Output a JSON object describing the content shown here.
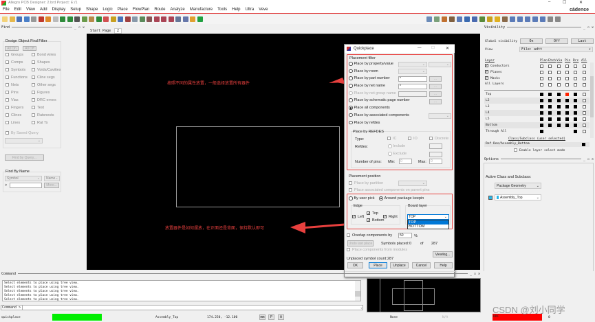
{
  "window": {
    "title": "Allegro PCB Designer: 2.brd  Project: E:/1",
    "brand": "cādence",
    "controls": [
      "–",
      "☐",
      "✕"
    ]
  },
  "menu": [
    "File",
    "Edit",
    "View",
    "Add",
    "Display",
    "Setup",
    "Shape",
    "Logic",
    "Place",
    "FlowPlan",
    "Route",
    "Analyze",
    "Manufacture",
    "Tools",
    "Help",
    "Ultra",
    "Veve"
  ],
  "toolbar_icons": [
    {
      "name": "new-file-icon",
      "color": "#f3d27a"
    },
    {
      "name": "open-folder-icon",
      "color": "#e6b84b"
    },
    {
      "name": "save-icon",
      "color": "#4a72b8"
    },
    {
      "name": "move-icon",
      "color": "#4a7fc8"
    },
    {
      "name": "copy-icon",
      "color": "#999999"
    },
    {
      "name": "delete-icon",
      "color": "#c0392b"
    },
    {
      "name": "undo-icon",
      "color": "#e08a2a"
    },
    {
      "name": "redo-icon",
      "color": "#bbbbbb"
    },
    {
      "name": "shape-icon",
      "color": "#2e8b3a"
    },
    {
      "name": "pin-icon",
      "color": "#2e8b3a"
    },
    {
      "name": "line-icon",
      "color": "#555555"
    },
    {
      "name": "text-add-icon",
      "color": "#6a9a4a"
    },
    {
      "name": "text-edit-icon",
      "color": "#b88a4a"
    },
    {
      "name": "layer-icon",
      "color": "#2e8b3a"
    },
    {
      "name": "frame-icon",
      "color": "#d05050"
    },
    {
      "name": "connect-icon",
      "color": "#c8a020"
    },
    {
      "name": "route-icon",
      "color": "#4a72b8"
    },
    {
      "name": "slide-icon",
      "color": "#a04040"
    },
    {
      "name": "grid-icon",
      "color": "#8899aa"
    },
    {
      "name": "grid2-icon",
      "color": "#5a8a5a"
    },
    {
      "name": "zoom-fit-icon",
      "color": "#885555"
    },
    {
      "name": "zoom-in-icon",
      "color": "#aa4455"
    },
    {
      "name": "zoom-out-icon",
      "color": "#aa4455"
    },
    {
      "name": "zoom-prev-icon",
      "color": "#aa4455"
    },
    {
      "name": "zoom-world-icon",
      "color": "#667799"
    },
    {
      "name": "zoom-select-icon",
      "color": "#6677aa"
    },
    {
      "name": "refresh-icon",
      "color": "#e0a030"
    },
    {
      "name": "3d-view-icon",
      "color": "#20a040"
    }
  ],
  "toolbar2_icons": [
    {
      "name": "table-icon",
      "color": "#6b8bb8"
    },
    {
      "name": "grid3-icon",
      "color": "#7aa07a"
    },
    {
      "name": "color-icon",
      "color": "#c07030"
    },
    {
      "name": "shadow-icon",
      "color": "#806040"
    },
    {
      "name": "info-icon",
      "color": "#5b7bb8"
    },
    {
      "name": "measure-icon",
      "color": "#3a6ab0"
    },
    {
      "name": "report-icon",
      "color": "#4a6ab0"
    },
    {
      "name": "drc-icon",
      "color": "#5a8a3a"
    },
    {
      "name": "highlight-icon",
      "color": "#c8a020"
    },
    {
      "name": "sun-icon",
      "color": "#e0b020"
    },
    {
      "name": "stackup-icon",
      "color": "#8a6a4a"
    },
    {
      "name": "panel1-icon",
      "color": "#5b7bb8"
    },
    {
      "name": "panel2-icon",
      "color": "#5b7bb8"
    },
    {
      "name": "panel3-icon",
      "color": "#5b7bb8"
    },
    {
      "name": "panel4-icon",
      "color": "#5b7bb8"
    },
    {
      "name": "panel5-icon",
      "color": "#5b7bb8"
    },
    {
      "name": "script-icon",
      "color": "#888888"
    },
    {
      "name": "settings-icon",
      "color": "#888888"
    }
  ],
  "find": {
    "title": "Find",
    "filter_title": "Design Object Find Filter",
    "all_on": "All On",
    "all_off": "All Off",
    "left_items": [
      "Groups",
      "Comps",
      "Symbols",
      "Functions",
      "Nets",
      "Pins",
      "Vias",
      "Fingers",
      "Clines",
      "Lines"
    ],
    "right_items": [
      "Bond wires",
      "Shapes",
      "Voids/Cavities",
      "Cline segs",
      "Other segs",
      "Figures",
      "DRC errors",
      "Text",
      "Ratsnests",
      "Rat Ts"
    ],
    "saved_query": "By Saved Query",
    "find_by_query": "Find by Query...",
    "find_by_name": "Find By Name",
    "type_select": "Symbol",
    "name_select": "Name",
    "prompt": ">",
    "name_input": "",
    "more": "More..."
  },
  "tabs": [
    "Start Page",
    "2"
  ],
  "annotations": {
    "note1": "按照不同的属性放置，一般选择放置所有器件",
    "note2": "放置器件是如何摆放，在正面还是背面，保持默认即可",
    "color": "#e8403e"
  },
  "quickplace": {
    "title": "Quickplace",
    "placement_filter": "Placement filter",
    "options": [
      {
        "label": "Place by property/value",
        "selected": false,
        "enabled": true
      },
      {
        "label": "Place by room",
        "selected": false,
        "enabled": true
      },
      {
        "label": "Place by part number",
        "selected": false,
        "enabled": true,
        "value": "*"
      },
      {
        "label": "Place by net name",
        "selected": false,
        "enabled": true,
        "value": "*"
      },
      {
        "label": "Place by net group name",
        "selected": false,
        "enabled": false
      },
      {
        "label": "Place by schematic page number",
        "selected": false,
        "enabled": true
      },
      {
        "label": "Place all components",
        "selected": true,
        "enabled": true
      },
      {
        "label": "Place by associated components",
        "selected": false,
        "enabled": true
      },
      {
        "label": "Place by refdes",
        "selected": false,
        "enabled": true
      }
    ],
    "browse": "...",
    "refdes_group": "Place by REFDES",
    "type_label": "Type:",
    "type_ic": "IC",
    "type_io": "IO",
    "type_discrete": "Discrete",
    "refdes_label": "Refdes:",
    "include": "Include",
    "exclude": "Exclude",
    "pins_label": "Number of pins:",
    "min_label": "Min:",
    "min_value": "0",
    "max_label": "Max:",
    "max_value": "0",
    "placement_position": "Placement position",
    "by_partition": "Place by partition",
    "assoc_parent": "Place associated components on parent pins",
    "by_user_pick": "By user pick",
    "around_keepin": "Around package keepin",
    "around_keepin_selected": true,
    "edge": "Edge",
    "edge_left": "Left",
    "edge_top": "Top",
    "edge_right": "Right",
    "edge_bottom": "Bottom",
    "board_layer": "Board layer",
    "board_layer_value": "TOP",
    "board_layer_options": [
      "TOP",
      "BOTTOM"
    ],
    "overlap": "Overlap components by",
    "overlap_value": "50",
    "overlap_unit": "%",
    "undo_last": "Undo last place",
    "symbols_placed": "Symbols placed:",
    "placed_count": "0",
    "of": "of",
    "total": "287",
    "from_modules": "Place components from modules",
    "viewlog": "Viewlog...",
    "unplaced_label": "Unplaced symbol count:",
    "unplaced_count": "287",
    "buttons": {
      "ok": "OK",
      "place": "Place",
      "unplace": "Unplace",
      "cancel": "Cancel",
      "help": "Help"
    }
  },
  "visibility": {
    "title": "Visibility",
    "global_label": "Global visibility",
    "on": "On",
    "off": "Off",
    "last": "Last",
    "view_label": "View",
    "view_value": "File: adtt",
    "layer_header": "Layer",
    "columns": [
      "Plan",
      "Etch",
      "Via",
      "Pin",
      "Drc",
      "All"
    ],
    "groups": [
      {
        "label": "Conductors",
        "checked": true
      },
      {
        "label": "Planes",
        "checked": true
      },
      {
        "label": "Masks",
        "checked": true
      },
      {
        "label": "All Layers",
        "checked": false
      }
    ],
    "layers": [
      {
        "name": "Top",
        "cells": [
          "k",
          "k",
          "k",
          "r",
          "k",
          "w"
        ]
      },
      {
        "name": "L2",
        "cells": [
          "k",
          "k",
          "k",
          "k",
          "k",
          "w"
        ]
      },
      {
        "name": "L3",
        "cells": [
          "k",
          "k",
          "k",
          "k",
          "k",
          "w"
        ]
      },
      {
        "name": "L4",
        "cells": [
          "k",
          "k",
          "k",
          "k",
          "k",
          "w"
        ]
      },
      {
        "name": "L5",
        "cells": [
          "k",
          "k",
          "k",
          "k",
          "k",
          "w"
        ]
      },
      {
        "name": "Bottom",
        "cells": [
          "k",
          "k",
          "k",
          "k",
          "k",
          "w"
        ]
      },
      {
        "name": "Through All",
        "cells": [
          "k",
          "",
          "",
          "",
          "k",
          "w"
        ]
      }
    ],
    "class_subclass": "Class/Subclass (user selected)",
    "ref_des": "Ref Des/Assembly_Bottom",
    "enable_layer_select": "Enable layer select mode"
  },
  "options": {
    "title": "Options",
    "active_label": "Active Class and Subclass:",
    "class_value": "Package Geometry",
    "subclass_value": "Assembly_Top",
    "subclass_color": "#29b6e8"
  },
  "command": {
    "title": "Command",
    "lines": [
      "Select elements to place using tree view.",
      "Select elements to place using tree view.",
      "Select elements to place using tree view.",
      "Select elements to place using tree view.",
      "Select elements to place using tree view."
    ],
    "prompt": "Command >",
    "input": ""
  },
  "status": {
    "command": "quickplace",
    "subclass": "Assembly_Top",
    "coords": "174.250, -12.100",
    "units": "mm",
    "p": "P",
    "a": "A",
    "mode": "None",
    "na": "N/A",
    "drc": "DRC",
    "drc_count": "0",
    "green": "#00ee00",
    "red": "#ff0000"
  },
  "watermark": "CSDN @刘小同学"
}
